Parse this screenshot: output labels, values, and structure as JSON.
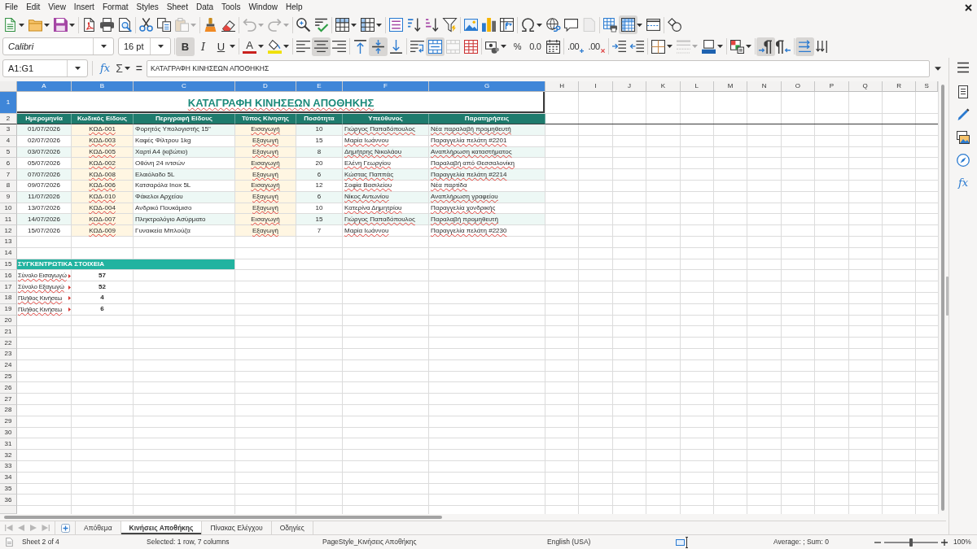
{
  "menu": [
    "File",
    "Edit",
    "View",
    "Insert",
    "Format",
    "Styles",
    "Sheet",
    "Data",
    "Tools",
    "Window",
    "Help"
  ],
  "toolbars": [
    {
      "groups": [
        [
          {
            "dropdown": true,
            "pressed": false,
            "disabled": false
          },
          {
            "dropdown": true,
            "pressed": false,
            "disabled": false
          },
          {
            "dropdown": true,
            "pressed": false,
            "disabled": false
          }
        ],
        [
          {
            "dropdown": false,
            "pressed": false,
            "disabled": false
          },
          {
            "dropdown": false,
            "pressed": false,
            "disabled": false
          },
          {
            "dropdown": false,
            "pressed": false,
            "disabled": false
          }
        ],
        [
          {
            "dropdown": false,
            "pressed": false,
            "disabled": false
          },
          {
            "dropdown": false,
            "pressed": false,
            "disabled": false
          },
          {
            "dropdown": true,
            "pressed": false,
            "disabled": true
          }
        ],
        [
          {
            "dropdown": false,
            "pressed": false,
            "disabled": false
          },
          {
            "dropdown": false,
            "pressed": false,
            "disabled": false
          }
        ],
        [
          {
            "dropdown": true,
            "pressed": false,
            "disabled": true
          },
          {
            "dropdown": true,
            "pressed": false,
            "disabled": true
          }
        ],
        [
          {
            "dropdown": false,
            "pressed": false,
            "disabled": false
          },
          {
            "dropdown": false,
            "pressed": false,
            "disabled": false
          }
        ],
        [
          {
            "dropdown": true,
            "pressed": false,
            "disabled": false
          },
          {
            "dropdown": true,
            "pressed": false,
            "disabled": false
          }
        ],
        [
          {
            "dropdown": false,
            "pressed": false,
            "disabled": false
          },
          {
            "dropdown": false,
            "pressed": false,
            "disabled": false
          },
          {
            "dropdown": false,
            "pressed": false,
            "disabled": false
          },
          {
            "dropdown": false,
            "pressed": false,
            "disabled": false
          }
        ],
        [
          {
            "dropdown": false,
            "pressed": false,
            "disabled": false
          },
          {
            "dropdown": false,
            "pressed": false,
            "disabled": false
          },
          {
            "dropdown": false,
            "pressed": false,
            "disabled": false
          }
        ],
        [
          {
            "dropdown": true,
            "pressed": false,
            "disabled": false
          },
          {
            "dropdown": false,
            "pressed": false,
            "disabled": false
          },
          {
            "dropdown": false,
            "pressed": false,
            "disabled": false
          },
          {
            "dropdown": false,
            "pressed": false,
            "disabled": true
          }
        ],
        [
          {
            "dropdown": false,
            "pressed": false,
            "disabled": false
          },
          {
            "dropdown": true,
            "pressed": true,
            "disabled": false
          },
          {
            "dropdown": false,
            "pressed": false,
            "disabled": false
          }
        ],
        [
          {
            "dropdown": false,
            "pressed": false,
            "disabled": false
          }
        ]
      ]
    },
    {
      "font_name": "Calibri",
      "font_size": "16 pt",
      "groups": [
        [
          {
            "glyph": "B",
            "dropdown": false,
            "pressed": true,
            "disabled": false
          },
          {
            "glyph": "I",
            "dropdown": false,
            "pressed": false,
            "disabled": false
          },
          {
            "glyph": "U",
            "dropdown": true,
            "pressed": false,
            "disabled": false
          }
        ],
        [
          {
            "glyph": "A",
            "dropdown": true,
            "pressed": false,
            "disabled": false
          },
          {
            "dropdown": true,
            "pressed": false,
            "disabled": false
          }
        ],
        [
          {
            "dropdown": false,
            "pressed": false,
            "disabled": false
          },
          {
            "dropdown": false,
            "pressed": true,
            "disabled": false
          },
          {
            "dropdown": false,
            "pressed": false,
            "disabled": false
          }
        ],
        [
          {
            "dropdown": false,
            "pressed": false,
            "disabled": false
          },
          {
            "dropdown": false,
            "pressed": true,
            "disabled": false
          },
          {
            "dropdown": false,
            "pressed": false,
            "disabled": false
          }
        ],
        [
          {
            "dropdown": false,
            "pressed": false,
            "disabled": false
          },
          {
            "dropdown": false,
            "pressed": true,
            "disabled": false
          },
          {
            "dropdown": false,
            "pressed": false,
            "disabled": true
          },
          {
            "dropdown": false,
            "pressed": false,
            "disabled": false
          }
        ],
        [
          {
            "dropdown": true,
            "pressed": false,
            "disabled": false
          },
          {
            "glyph": "%",
            "dropdown": false,
            "pressed": false,
            "disabled": false
          },
          {
            "glyph": "0.0",
            "dropdown": false,
            "pressed": false,
            "disabled": false
          },
          {
            "dropdown": false,
            "pressed": false,
            "disabled": false
          }
        ],
        [
          {
            "glyph": ".00",
            "dropdown": false,
            "pressed": false,
            "disabled": false
          },
          {
            "glyph": ".00",
            "dropdown": false,
            "pressed": false,
            "disabled": false
          }
        ],
        [
          {
            "dropdown": false,
            "pressed": false,
            "disabled": false
          },
          {
            "dropdown": false,
            "pressed": false,
            "disabled": false
          }
        ],
        [
          {
            "dropdown": true,
            "pressed": false,
            "disabled": false
          },
          {
            "dropdown": true,
            "pressed": false,
            "disabled": true
          },
          {
            "dropdown": true,
            "pressed": false,
            "disabled": false
          }
        ],
        [
          {
            "dropdown": true,
            "pressed": false,
            "disabled": false
          }
        ],
        [
          {
            "dropdown": false,
            "pressed": true,
            "disabled": false
          },
          {
            "dropdown": false,
            "pressed": false,
            "disabled": false
          }
        ],
        [
          {
            "dropdown": false,
            "pressed": true,
            "disabled": false
          },
          {
            "dropdown": false,
            "pressed": false,
            "disabled": false
          }
        ]
      ]
    }
  ],
  "formula_bar": {
    "name_box": "A1:G1",
    "buttons": [
      {
        "glyph": "fx",
        "dropdown": false
      },
      {
        "glyph": "Σ",
        "dropdown": true
      },
      {
        "glyph": "=",
        "dropdown": false
      }
    ],
    "content": "ΚΑΤΑΓΡΑΦΗ ΚΙΝΗΣΕΩΝ ΑΠΟΘΗΚΗΣ"
  },
  "sidebar": {
    "function_glyph": "fx"
  },
  "sheet": {
    "columns": [
      {
        "label": "A",
        "selected": true
      },
      {
        "label": "B",
        "selected": true
      },
      {
        "label": "C",
        "selected": true
      },
      {
        "label": "D",
        "selected": true
      },
      {
        "label": "E",
        "selected": true
      },
      {
        "label": "F",
        "selected": true
      },
      {
        "label": "G",
        "selected": true
      },
      {
        "label": "H",
        "selected": false
      },
      {
        "label": "I",
        "selected": false
      },
      {
        "label": "J",
        "selected": false
      },
      {
        "label": "K",
        "selected": false
      },
      {
        "label": "L",
        "selected": false
      },
      {
        "label": "M",
        "selected": false
      },
      {
        "label": "N",
        "selected": false
      },
      {
        "label": "O",
        "selected": false
      },
      {
        "label": "P",
        "selected": false
      },
      {
        "label": "Q",
        "selected": false
      },
      {
        "label": "R",
        "selected": false
      },
      {
        "label": "S",
        "selected": false
      }
    ],
    "rows": [
      {
        "label": "1",
        "selected": true
      },
      {
        "label": "2",
        "selected": false
      },
      {
        "label": "3",
        "selected": false
      },
      {
        "label": "4",
        "selected": false
      },
      {
        "label": "5",
        "selected": false
      },
      {
        "label": "6",
        "selected": false
      },
      {
        "label": "7",
        "selected": false
      },
      {
        "label": "8",
        "selected": false
      },
      {
        "label": "9",
        "selected": false
      },
      {
        "label": "10",
        "selected": false
      },
      {
        "label": "11",
        "selected": false
      },
      {
        "label": "12",
        "selected": false
      },
      {
        "label": "13",
        "selected": false
      },
      {
        "label": "14",
        "selected": false
      },
      {
        "label": "15",
        "selected": false
      },
      {
        "label": "16",
        "selected": false
      },
      {
        "label": "17",
        "selected": false
      },
      {
        "label": "18",
        "selected": false
      },
      {
        "label": "19",
        "selected": false
      },
      {
        "label": "20",
        "selected": false
      },
      {
        "label": "21",
        "selected": false
      },
      {
        "label": "22",
        "selected": false
      },
      {
        "label": "23",
        "selected": false
      },
      {
        "label": "24",
        "selected": false
      },
      {
        "label": "25",
        "selected": false
      },
      {
        "label": "26",
        "selected": false
      },
      {
        "label": "27",
        "selected": false
      },
      {
        "label": "28",
        "selected": false
      },
      {
        "label": "29",
        "selected": false
      },
      {
        "label": "30",
        "selected": false
      },
      {
        "label": "31",
        "selected": false
      },
      {
        "label": "32",
        "selected": false
      },
      {
        "label": "33",
        "selected": false
      },
      {
        "label": "34",
        "selected": false
      },
      {
        "label": "35",
        "selected": false
      },
      {
        "label": "36",
        "selected": false
      }
    ],
    "title": {
      "text": "ΚΑΤΑΓΡΑΦΗ ΚΙΝΗΣΕΩΝ ΑΠΟΘΗΚΗΣ",
      "selected": true,
      "spell_marked": true
    },
    "table": {
      "columns": [
        {
          "label": "Ημερομηνία",
          "kind": "date",
          "spell_marked": false
        },
        {
          "label": "Κωδικός Είδους",
          "kind": "code",
          "spell_marked": true
        },
        {
          "label": "Περιγραφή Είδους",
          "kind": "text",
          "spell_marked": false
        },
        {
          "label": "Τύπος Κίνησης",
          "kind": "type",
          "spell_marked": true
        },
        {
          "label": "Ποσότητα",
          "kind": "number",
          "spell_marked": false
        },
        {
          "label": "Υπεύθυνος",
          "kind": "name",
          "spell_marked": true
        },
        {
          "label": "Παρατηρήσεις",
          "kind": "note",
          "spell_marked": true
        }
      ],
      "rows": [
        [
          "01/07/2026",
          "ΚΩΔ-001",
          "Φορητός Υπολογιστής 15\"",
          "Εισαγωγή",
          "10",
          "Γιώργος Παπαδόπουλος",
          "Νέα παραλαβή προμηθευτή"
        ],
        [
          "02/07/2026",
          "ΚΩΔ-003",
          "Καφές Φίλτρου 1kg",
          "Εξαγωγή",
          "15",
          "Μαρία Ιωάννου",
          "Παραγγελία πελάτη #2201"
        ],
        [
          "03/07/2026",
          "ΚΩΔ-005",
          "Χαρτί Α4 (κιβώτιο)",
          "Εξαγωγή",
          "8",
          "Δημήτρης Νικολάου",
          "Αναπλήρωση καταστήματος"
        ],
        [
          "05/07/2026",
          "ΚΩΔ-002",
          "Οθόνη 24 ιντσών",
          "Εισαγωγή",
          "20",
          "Ελένη Γεωργίου",
          "Παραλαβή από Θεσσαλονίκη"
        ],
        [
          "07/07/2026",
          "ΚΩΔ-008",
          "Ελαιόλαδο 5L",
          "Εξαγωγή",
          "6",
          "Κώστας Παππάς",
          "Παραγγελία πελάτη #2214"
        ],
        [
          "09/07/2026",
          "ΚΩΔ-006",
          "Κατσαρόλα Inox 5L",
          "Εισαγωγή",
          "12",
          "Σοφία Βασιλείου",
          "Νέα παρτίδα"
        ],
        [
          "11/07/2026",
          "ΚΩΔ-010",
          "Φάκελοι Αρχείου",
          "Εξαγωγή",
          "6",
          "Νίκος Αντωνίου",
          "Αναπλήρωση γραφείου"
        ],
        [
          "13/07/2026",
          "ΚΩΔ-004",
          "Ανδρικό Πουκάμισο",
          "Εξαγωγή",
          "10",
          "Κατερίνα Δημητρίου",
          "Παραγγελία χονδρικής"
        ],
        [
          "14/07/2026",
          "ΚΩΔ-007",
          "Πληκτρολόγιο Ασύρματο",
          "Εισαγωγή",
          "15",
          "Γιώργος Παπαδόπουλος",
          "Παραλαβή προμηθευτή"
        ],
        [
          "15/07/2026",
          "ΚΩΔ-009",
          "Γυναικεία Μπλούζα",
          "Εξαγωγή",
          "7",
          "Μαρία Ιωάννου",
          "Παραγγελία πελάτη #2230"
        ]
      ]
    },
    "summary": {
      "title": "ΣΥΓΚΕΝΤΡΩΤΙΚΑ ΣΤΟΙΧΕΙΑ",
      "rows": [
        {
          "label": "Σύνολο Εισαγωγώ",
          "clipped": true,
          "spell_marked": true,
          "value": "57"
        },
        {
          "label": "Σύνολο Εξαγωγώ",
          "clipped": true,
          "spell_marked": true,
          "value": "52"
        },
        {
          "label": "Πλήθος Κινήσεω",
          "clipped": true,
          "spell_marked": true,
          "value": "4"
        },
        {
          "label": "Πλήθος Κινήσεω",
          "clipped": true,
          "spell_marked": true,
          "value": "6"
        }
      ]
    }
  },
  "sheet_tabs": {
    "nav_disabled": true,
    "tabs": [
      {
        "label": "Απόθεμα",
        "selected": false
      },
      {
        "label": "Κινήσεις Αποθήκης",
        "selected": true
      },
      {
        "label": "Πίνακας Ελέγχου",
        "selected": false
      },
      {
        "label": "Οδηγίες",
        "selected": false
      }
    ]
  },
  "status_bar": {
    "sheet": "Sheet 2 of 4",
    "selection": "Selected: 1 row, 7 columns",
    "page_style": "PageStyle_Κινήσεις Αποθήκης",
    "language": "English (USA)",
    "summary": "Average: ; Sum: 0",
    "zoom": {
      "level": 0.5,
      "reading": "100%"
    }
  }
}
